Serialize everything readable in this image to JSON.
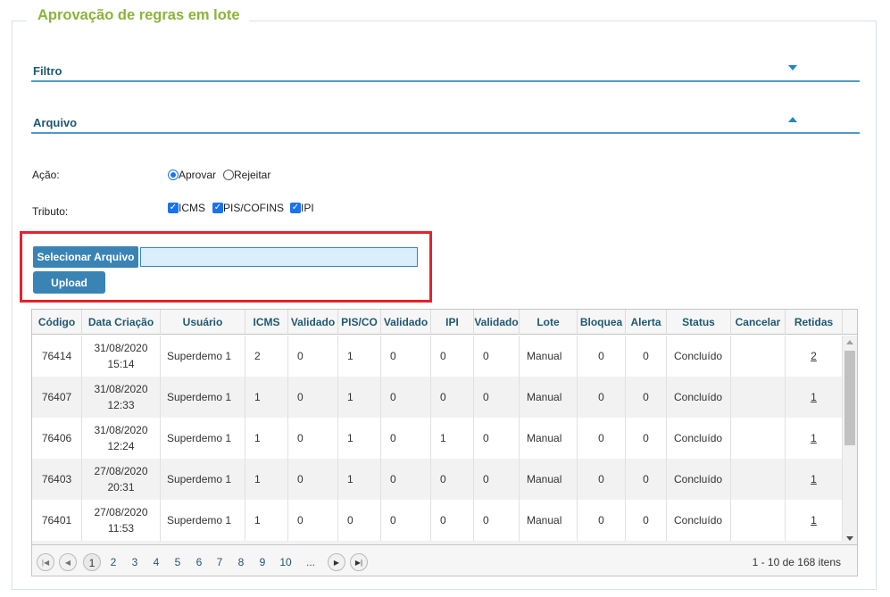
{
  "title": "Aprovação de regras em lote",
  "sections": {
    "filtro": "Filtro",
    "arquivo": "Arquivo"
  },
  "acao": {
    "label": "Ação:",
    "options": [
      "Aprovar",
      "Rejeitar"
    ],
    "selected": "Aprovar"
  },
  "tributo": {
    "label": "Tributo:",
    "options": [
      "ICMS",
      "PIS/COFINS",
      "IPI"
    ],
    "checked": [
      "ICMS",
      "PIS/COFINS",
      "IPI"
    ]
  },
  "upload": {
    "select_label": "Selecionar Arquivo",
    "file_value": "",
    "upload_label": "Upload"
  },
  "table": {
    "columns": [
      "Código",
      "Data Criação",
      "Usuário",
      "ICMS",
      "Validado",
      "PIS/CO",
      "Validado",
      "IPI",
      "Validado",
      "Lote",
      "Bloquea",
      "Alerta",
      "Status",
      "Cancelar",
      "Retidas"
    ],
    "rows": [
      {
        "codigo": "76414",
        "data": "31/08/2020",
        "hora": "15:14",
        "usuario": "Superdemo 1",
        "icms": "2",
        "val1": "0",
        "pis": "1",
        "val2": "0",
        "ipi": "0",
        "val3": "0",
        "lote": "Manual",
        "bloq": "0",
        "alerta": "0",
        "status": "Concluído",
        "cancelar": "",
        "retidas": "2"
      },
      {
        "codigo": "76407",
        "data": "31/08/2020",
        "hora": "12:33",
        "usuario": "Superdemo 1",
        "icms": "1",
        "val1": "0",
        "pis": "1",
        "val2": "0",
        "ipi": "0",
        "val3": "0",
        "lote": "Manual",
        "bloq": "0",
        "alerta": "0",
        "status": "Concluído",
        "cancelar": "",
        "retidas": "1"
      },
      {
        "codigo": "76406",
        "data": "31/08/2020",
        "hora": "12:24",
        "usuario": "Superdemo 1",
        "icms": "1",
        "val1": "0",
        "pis": "1",
        "val2": "0",
        "ipi": "1",
        "val3": "0",
        "lote": "Manual",
        "bloq": "0",
        "alerta": "0",
        "status": "Concluído",
        "cancelar": "",
        "retidas": "1"
      },
      {
        "codigo": "76403",
        "data": "27/08/2020",
        "hora": "20:31",
        "usuario": "Superdemo 1",
        "icms": "1",
        "val1": "0",
        "pis": "1",
        "val2": "0",
        "ipi": "0",
        "val3": "0",
        "lote": "Manual",
        "bloq": "0",
        "alerta": "0",
        "status": "Concluído",
        "cancelar": "",
        "retidas": "1"
      },
      {
        "codigo": "76401",
        "data": "27/08/2020",
        "hora": "11:53",
        "usuario": "Superdemo 1",
        "icms": "1",
        "val1": "0",
        "pis": "0",
        "val2": "0",
        "ipi": "0",
        "val3": "0",
        "lote": "Manual",
        "bloq": "0",
        "alerta": "0",
        "status": "Concluído",
        "cancelar": "",
        "retidas": "1"
      }
    ]
  },
  "pager": {
    "pages": [
      "1",
      "2",
      "3",
      "4",
      "5",
      "6",
      "7",
      "8",
      "9",
      "10",
      "..."
    ],
    "current": "1",
    "info": "1 - 10 de 168 itens"
  },
  "colors": {
    "title": "#8cb33a",
    "section": "#1e5873",
    "button": "#3a84b5",
    "highlight": "#e3232d"
  }
}
